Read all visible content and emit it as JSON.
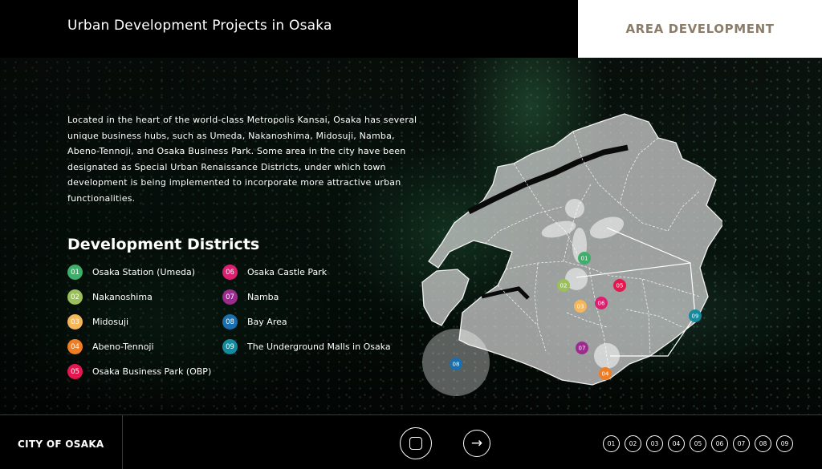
{
  "header": {
    "title": "Urban Development Projects in Osaka",
    "section": "AREA DEVELOPMENT"
  },
  "intro": "Located in the heart of the world-class Metropolis Kansai, Osaka has several unique business hubs, such as Umeda, Nakanoshima, Midosuji, Namba, Abeno-Tennoji, and Osaka Business Park. Some area in the city have been designated as Special Urban Renaissance Districts, under which town development is being implemented to incorporate more attractive urban functionalities.",
  "districts_title": "Development Districts",
  "districts": [
    {
      "num": "01",
      "label": "Osaka Station (Umeda)",
      "color": "#3fae6b"
    },
    {
      "num": "02",
      "label": "Nakanoshima",
      "color": "#9bbf5a"
    },
    {
      "num": "03",
      "label": "Midosuji",
      "color": "#f6b65a"
    },
    {
      "num": "04",
      "label": "Abeno-Tennoji",
      "color": "#ef7d23"
    },
    {
      "num": "05",
      "label": "Osaka Business Park (OBP)",
      "color": "#e4174f"
    },
    {
      "num": "06",
      "label": "Osaka Castle Park",
      "color": "#dc1f6e"
    },
    {
      "num": "07",
      "label": "Namba",
      "color": "#9b2b8f"
    },
    {
      "num": "08",
      "label": "Bay Area",
      "color": "#1a6fae"
    },
    {
      "num": "09",
      "label": "The Underground Malls in Osaka",
      "color": "#138a9e"
    }
  ],
  "footer": {
    "city": "CITY OF OSAKA",
    "home_icon": "home-square-icon",
    "next_icon": "arrow-right-icon",
    "next_glyph": "→",
    "pages": [
      "01",
      "02",
      "03",
      "04",
      "05",
      "06",
      "07",
      "08",
      "09"
    ]
  }
}
